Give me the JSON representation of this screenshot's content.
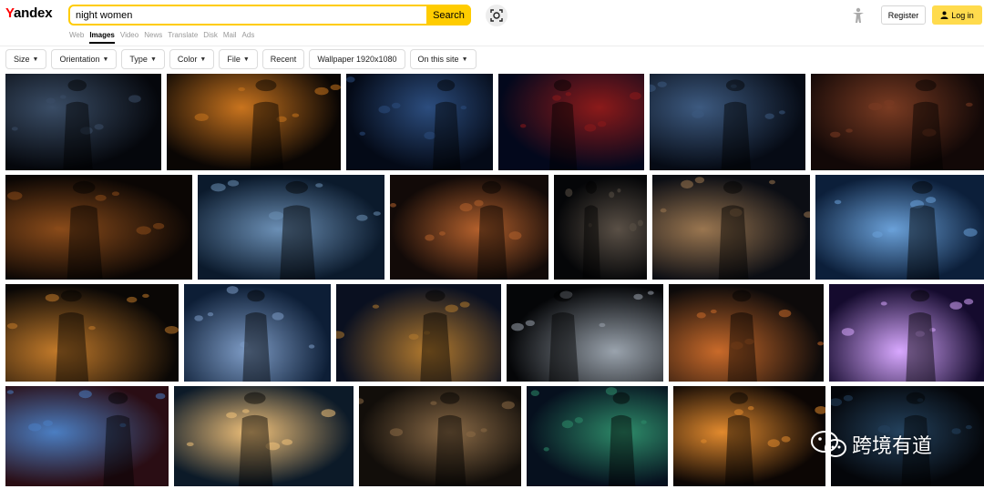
{
  "header": {
    "logo": "Yandex",
    "search_value": "night women",
    "search_button": "Search",
    "services": [
      "Web",
      "Images",
      "Video",
      "News",
      "Translate",
      "Disk",
      "Mail",
      "Ads"
    ],
    "active_service": "Images",
    "register": "Register",
    "login": "Log in"
  },
  "filters": [
    {
      "label": "Size",
      "dropdown": true
    },
    {
      "label": "Orientation",
      "dropdown": true
    },
    {
      "label": "Type",
      "dropdown": true
    },
    {
      "label": "Color",
      "dropdown": true
    },
    {
      "label": "File",
      "dropdown": true
    },
    {
      "label": "Recent",
      "dropdown": false
    },
    {
      "label": "Wallpaper 1920x1080",
      "dropdown": false
    },
    {
      "label": "On this site",
      "dropdown": true
    }
  ],
  "watermark": {
    "text": "跨境有道"
  },
  "colors": {
    "accent": "#ffcc00",
    "login_bg": "#ffdb4d"
  }
}
